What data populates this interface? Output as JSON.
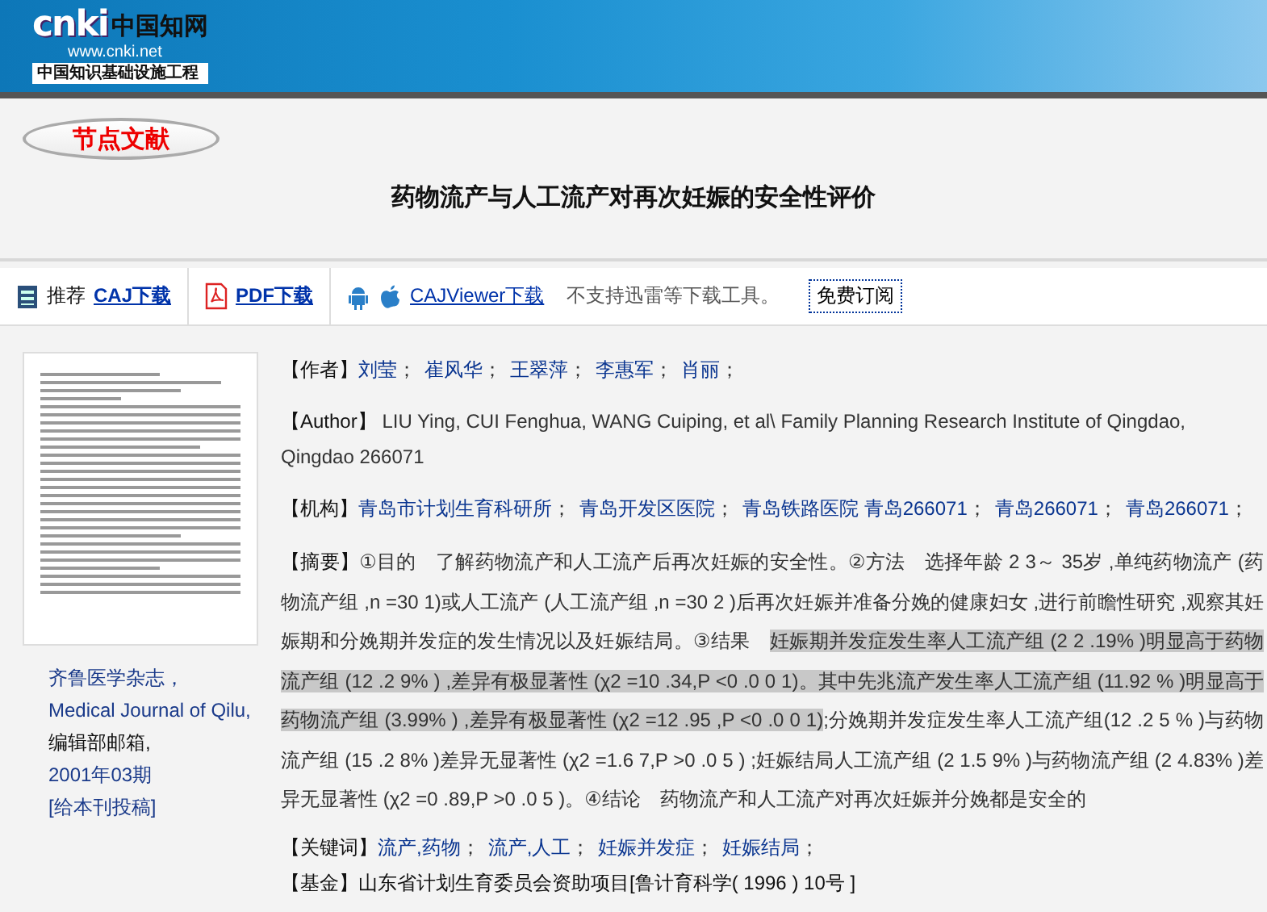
{
  "logo": {
    "mark": "cnki",
    "name": "中国知网",
    "url": "www.cnki.net",
    "slogan": "中国知识基础设施工程"
  },
  "tab": {
    "label": "节点文献",
    "selected": true
  },
  "title": "药物流产与人工流产对再次妊娠的安全性评价",
  "toolbar": {
    "recommend": "推荐",
    "caj_link": "CAJ下载",
    "pdf_link": "PDF下载",
    "viewer_link": "CAJViewer下载",
    "notice": "不支持迅雷等下载工具。",
    "subscribe_button": "免费订阅"
  },
  "journal": {
    "name": "齐鲁医学杂志，",
    "english_name": "Medical Journal of Qilu,",
    "email_label": "编辑部邮箱,",
    "issue": "2001年03期",
    "submit_link": "[给本刊投稿]"
  },
  "authors": {
    "label": "【作者】",
    "items": [
      {
        "name": "刘莹",
        "sep": "；"
      },
      {
        "name": "崔风华",
        "sep": "；"
      },
      {
        "name": "王翠萍",
        "sep": "；"
      },
      {
        "name": "李惠军",
        "sep": "；"
      },
      {
        "name": "肖丽",
        "sep": "；"
      }
    ]
  },
  "author_en": {
    "label": "【Author】",
    "text": "LIU Ying, CUI Fenghua, WANG Cuiping, et al\\ Family Planning Research Institute of Qingdao, Qingdao 266071"
  },
  "institutions": {
    "label": "【机构】",
    "items": [
      {
        "name": "青岛市计划生育科研所",
        "sep": "；"
      },
      {
        "name": "青岛开发区医院",
        "sep": "；"
      },
      {
        "name": "青岛铁路医院 青岛266071",
        "sep": "；"
      },
      {
        "name": "青岛266071",
        "sep": "；"
      },
      {
        "name": "青岛266071",
        "sep": "；"
      }
    ]
  },
  "abstract": {
    "label": "【摘要】",
    "segments": [
      {
        "text": "①目的　了解药物流产和人工流产后再次妊娠的安全性。②方法　选择年龄 2 3～ 35岁 ,单纯药物流产 (药物流产组 ,n =30 1)或人工流产 (人工流产组 ,n =30 2 )后再次妊娠并准备分娩的健康妇女 ,进行前瞻性研究 ,观察其妊娠期和分娩期并发症的发生情况以及妊娠结局。③结果　",
        "highlighted": false
      },
      {
        "text": "妊娠期并发症发生率人工流产组 (2 2 .19% )明显高于药物流产组 (12 .2 9% ) ,差异有极显著性 (χ2 =10 .34,P <0 .0 0 1)。其中先兆流产发生率人工流产组 (11.92 % )明显高于药物流产组 (3.99% ) ,差异有极显著性 (χ2 =12 .95 ,P <0 .0 0 1)",
        "highlighted": true
      },
      {
        "text": ";分娩期并发症发生率人工流产组(12 .2 5 % )与药物流产组 (15 .2 8% )差异无显著性 (χ2 =1.6 7,P >0 .0 5 ) ;妊娠结局人工流产组 (2 1.5 9% )与药物流产组 (2 4.83% )差异无显著性 (χ2 =0 .89,P >0 .0 5 )。④结论　药物流产和人工流产对再次妊娠并分娩都是安全的",
        "highlighted": false
      }
    ]
  },
  "keywords": {
    "label": "【关键词】",
    "items": [
      {
        "name": "流产,药物",
        "sep": "；"
      },
      {
        "name": "流产,人工",
        "sep": "；"
      },
      {
        "name": "妊娠并发症",
        "sep": "；"
      },
      {
        "name": "妊娠结局",
        "sep": "；"
      }
    ]
  },
  "fund": {
    "label": "【基金】",
    "text": "山东省计划生育委员会资助项目[鲁计育科学( 1996 ) 10号 ]"
  }
}
